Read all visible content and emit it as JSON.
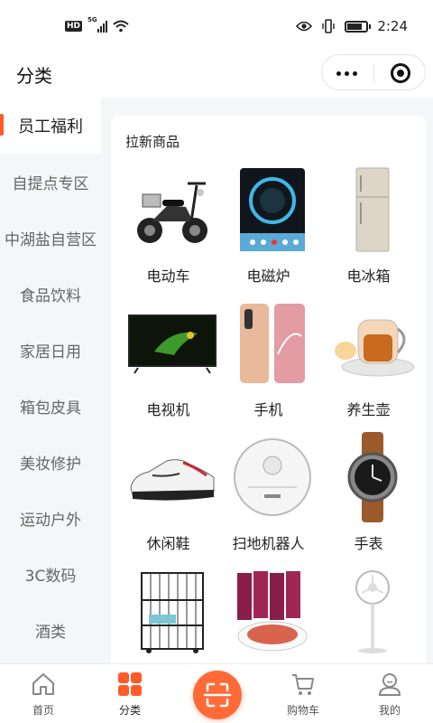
{
  "status_bar": {
    "time": "2:24",
    "hd": "HD",
    "network": "5G"
  },
  "header": {
    "title": "分类"
  },
  "sidebar": {
    "items": [
      {
        "label": "员工福利",
        "active": true
      },
      {
        "label": "自提点专区"
      },
      {
        "label": "中湖盐自营区"
      },
      {
        "label": "食品饮料"
      },
      {
        "label": "家居日用"
      },
      {
        "label": "箱包皮具"
      },
      {
        "label": "美妆修护"
      },
      {
        "label": "运动户外"
      },
      {
        "label": "3C数码"
      },
      {
        "label": "酒类"
      }
    ]
  },
  "main": {
    "section_title": "拉新商品",
    "products": [
      {
        "name": "电动车",
        "icon": "electric-scooter"
      },
      {
        "name": "电磁炉",
        "icon": "induction-cooker"
      },
      {
        "name": "电冰箱",
        "icon": "refrigerator"
      },
      {
        "name": "电视机",
        "icon": "television"
      },
      {
        "name": "手机",
        "icon": "smartphone"
      },
      {
        "name": "养生壶",
        "icon": "health-kettle"
      },
      {
        "name": "休闲鞋",
        "icon": "casual-shoe"
      },
      {
        "name": "扫地机器人",
        "icon": "robot-vacuum"
      },
      {
        "name": "手表",
        "icon": "wristwatch"
      },
      {
        "name": "",
        "icon": "pet-cage"
      },
      {
        "name": "",
        "icon": "food-packages"
      },
      {
        "name": "",
        "icon": "standing-fan"
      }
    ]
  },
  "tabbar": {
    "items": [
      {
        "label": "首页",
        "icon": "home-icon"
      },
      {
        "label": "分类",
        "icon": "category-icon",
        "active": true
      },
      {
        "label": "",
        "icon": "scan-icon"
      },
      {
        "label": "购物车",
        "icon": "cart-icon"
      },
      {
        "label": "我的",
        "icon": "profile-icon"
      }
    ]
  },
  "colors": {
    "accent": "#ff5a2a",
    "scan": "#ff6a36"
  }
}
